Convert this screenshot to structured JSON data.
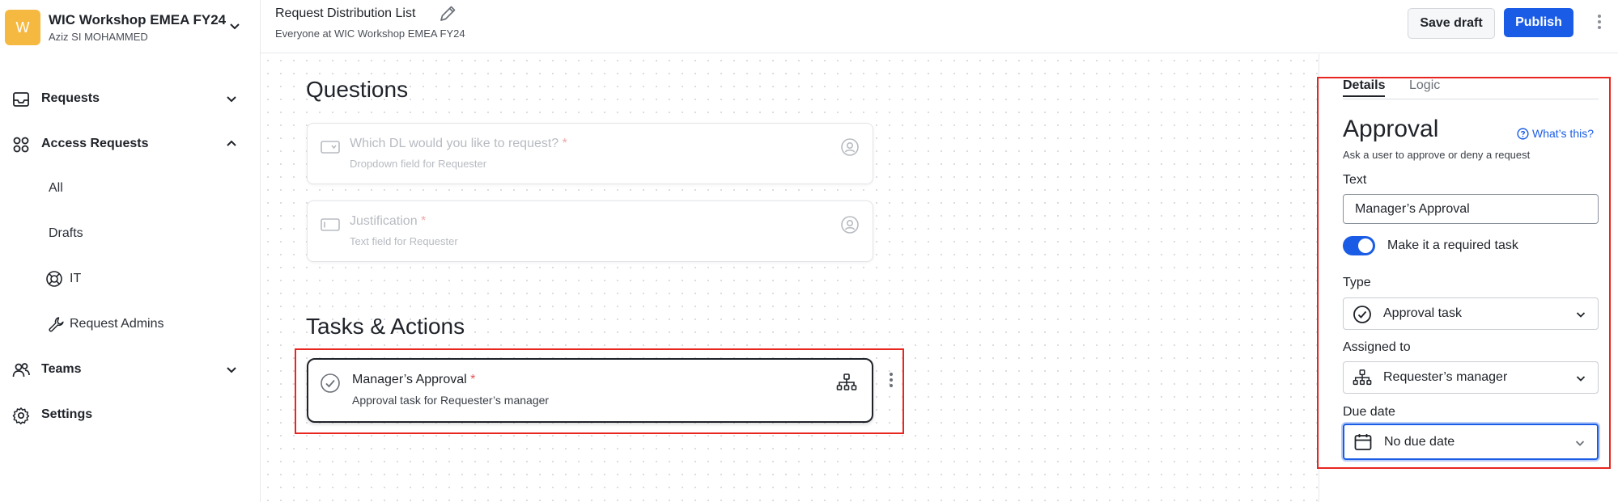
{
  "workspace": {
    "avatar_letter": "W",
    "name": "WIC Workshop EMEA FY24",
    "user": "Aziz SI MOHAMMED"
  },
  "sidebar": {
    "items": [
      {
        "label": "Requests",
        "icon": "inbox-icon",
        "state": "collapsed"
      },
      {
        "label": "Access Requests",
        "icon": "apps-grid-icon",
        "state": "expanded"
      },
      {
        "label": "Teams",
        "icon": "people-icon",
        "state": "collapsed"
      },
      {
        "label": "Settings",
        "icon": "gear-icon"
      }
    ],
    "access_sub": [
      {
        "label": "All"
      },
      {
        "label": "Drafts"
      },
      {
        "label": "IT",
        "icon": "lifebuoy-icon"
      },
      {
        "label": "Request Admins",
        "icon": "wrench-icon"
      }
    ]
  },
  "header": {
    "title": "Request Distribution List",
    "subtitle": "Everyone at WIC Workshop EMEA FY24",
    "save_draft": "Save draft",
    "publish": "Publish"
  },
  "canvas": {
    "questions_heading": "Questions",
    "questions": [
      {
        "title": "Which DL would you like to request?",
        "required_mark": "*",
        "subtitle": "Dropdown field for Requester"
      },
      {
        "title": "Justification",
        "required_mark": "*",
        "subtitle": "Text field for Requester"
      }
    ],
    "tasks_heading": "Tasks & Actions",
    "task": {
      "title": "Manager’s Approval",
      "required_mark": "*",
      "subtitle": "Approval task for Requester’s manager"
    }
  },
  "panel": {
    "tabs": [
      "Details",
      "Logic"
    ],
    "active_tab": "Details",
    "title": "Approval",
    "help_link": "What’s this?",
    "description": "Ask a user to approve or deny a request",
    "text_label": "Text",
    "text_value": "Manager’s Approval",
    "required_toggle_label": "Make it a required task",
    "required_toggle_on": true,
    "type_label": "Type",
    "type_value": "Approval task",
    "assigned_label": "Assigned to",
    "assigned_value": "Requester’s manager",
    "due_label": "Due date",
    "due_value": "No due date"
  },
  "colors": {
    "accent": "#1a5ce5",
    "highlight": "#e8251f",
    "workspace_avatar": "#f5b942"
  }
}
